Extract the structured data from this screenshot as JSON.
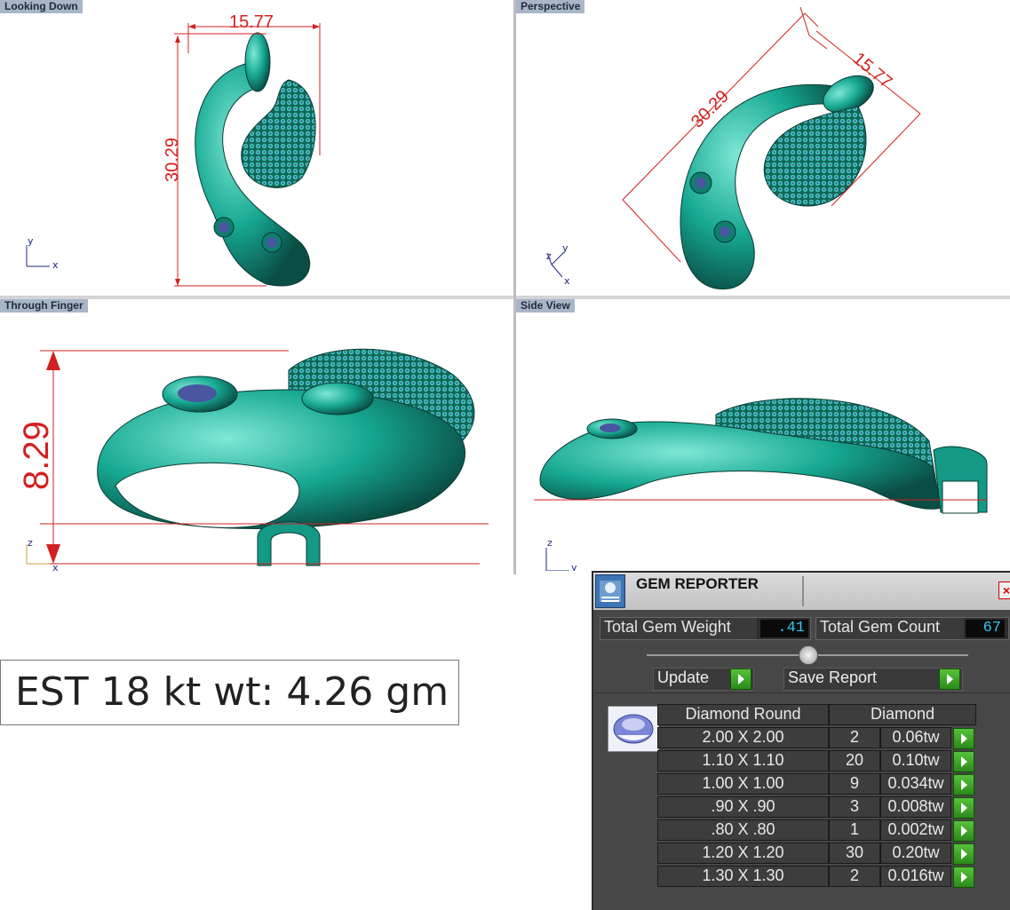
{
  "viewports": {
    "top_left": {
      "title": "Looking Down",
      "dim_width": "15.77",
      "dim_height": "30.29",
      "axis1": "y",
      "axis2": "x"
    },
    "top_right": {
      "title": "Perspective",
      "dim_length": "30.29",
      "dim_width": "15.77",
      "axis1": "z",
      "axis2": "y",
      "axis3": "x"
    },
    "bottom_left": {
      "title": "Through Finger",
      "dim_height": "8.29",
      "axis1": "z",
      "axis2": "x"
    },
    "bottom_right": {
      "title": "Side View",
      "axis1": "z",
      "axis2": "y"
    }
  },
  "estimate": {
    "text": "EST 18 kt wt: 4.26 gm"
  },
  "gem_reporter": {
    "title": "GEM REPORTER",
    "close": "×",
    "total_weight_label": "Total Gem Weight",
    "total_weight_value": ".41",
    "total_count_label": "Total Gem Count",
    "total_count_value": "67",
    "update_label": "Update",
    "save_label": "Save Report",
    "table_headers": [
      "Diamond Round",
      "Diamond"
    ],
    "rows": [
      {
        "size": "2.00 X 2.00",
        "count": "2",
        "weight": "0.06tw"
      },
      {
        "size": "1.10 X 1.10",
        "count": "20",
        "weight": "0.10tw"
      },
      {
        "size": "1.00 X 1.00",
        "count": "9",
        "weight": "0.034tw"
      },
      {
        "size": ".90 X .90",
        "count": "3",
        "weight": "0.008tw"
      },
      {
        "size": ".80 X .80",
        "count": "1",
        "weight": "0.002tw"
      },
      {
        "size": "1.20 X 1.20",
        "count": "30",
        "weight": "0.20tw"
      },
      {
        "size": "1.30 X 1.30",
        "count": "2",
        "weight": "0.016tw"
      }
    ]
  },
  "colors": {
    "metal": "#1bb39e",
    "dimension": "#d32020",
    "gem": "#5a5fa8"
  }
}
